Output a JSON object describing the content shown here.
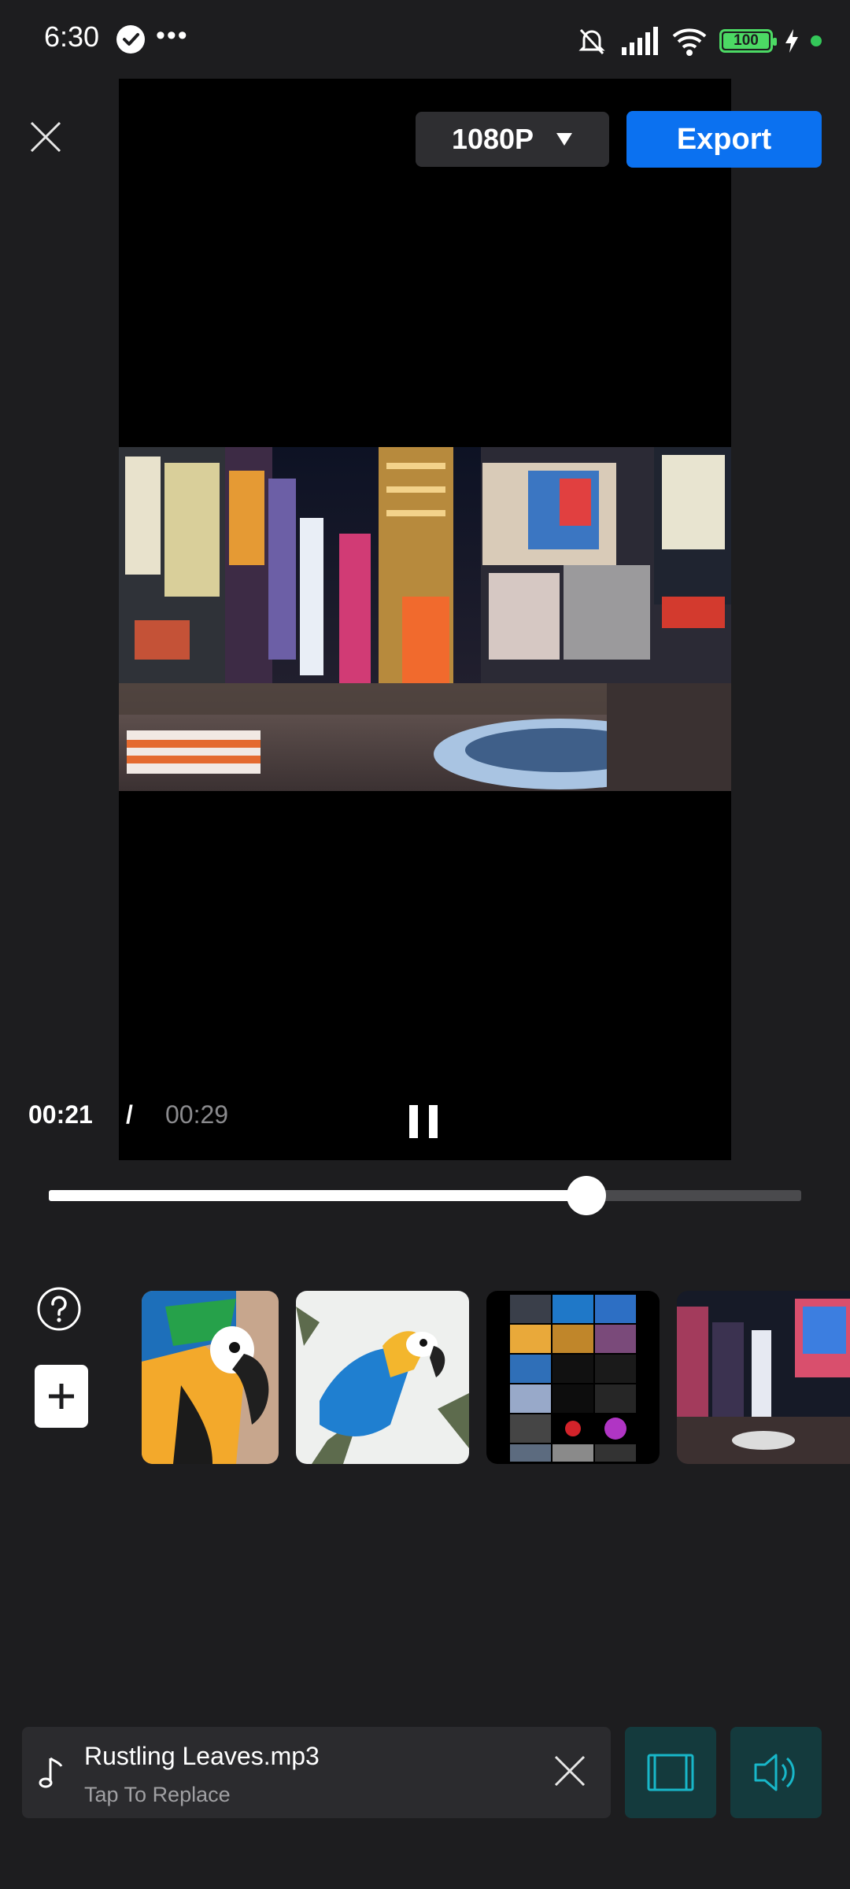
{
  "status_bar": {
    "time": "6:30",
    "more": "•••",
    "battery": "100"
  },
  "toolbar": {
    "resolution": "1080P",
    "export_label": "Export"
  },
  "player": {
    "current_time": "00:21",
    "separator": "/",
    "total_time": "00:29",
    "progress": 0.714
  },
  "thumbnails": [
    {
      "name": "parrot-closeup"
    },
    {
      "name": "parrot-on-branch"
    },
    {
      "name": "photo-collage"
    },
    {
      "name": "times-square-night"
    }
  ],
  "audio": {
    "title": "Rustling Leaves.mp3",
    "subtitle": "Tap To Replace"
  },
  "colors": {
    "accent": "#0b71f0",
    "tool_bg": "#143a3d",
    "tool_icon": "#18b7c9"
  }
}
